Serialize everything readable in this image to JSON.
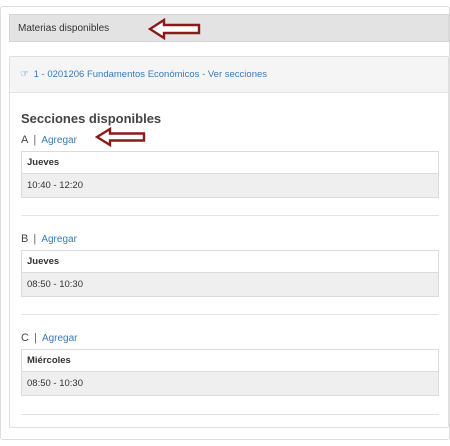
{
  "header": {
    "title": "Materias disponibles"
  },
  "subject": {
    "text": "1 - 0201206 Fundamentos Económicos - Ver secciones"
  },
  "sections_title": "Secciones disponibles",
  "add_label": "Agregar",
  "sections": [
    {
      "letter": "A",
      "day": "Jueves",
      "time": "10:40 - 12:20"
    },
    {
      "letter": "B",
      "day": "Jueves",
      "time": "08:50 - 10:30"
    },
    {
      "letter": "C",
      "day": "Miércoles",
      "time": "08:50 - 10:30"
    }
  ],
  "colors": {
    "accent": "#3b7ab7",
    "arrow": "#8b1a1a",
    "header_bg": "#e3e3e3"
  },
  "icons": {
    "hand": "hand-pointing-right-icon",
    "arrow": "arrow-left-icon"
  }
}
